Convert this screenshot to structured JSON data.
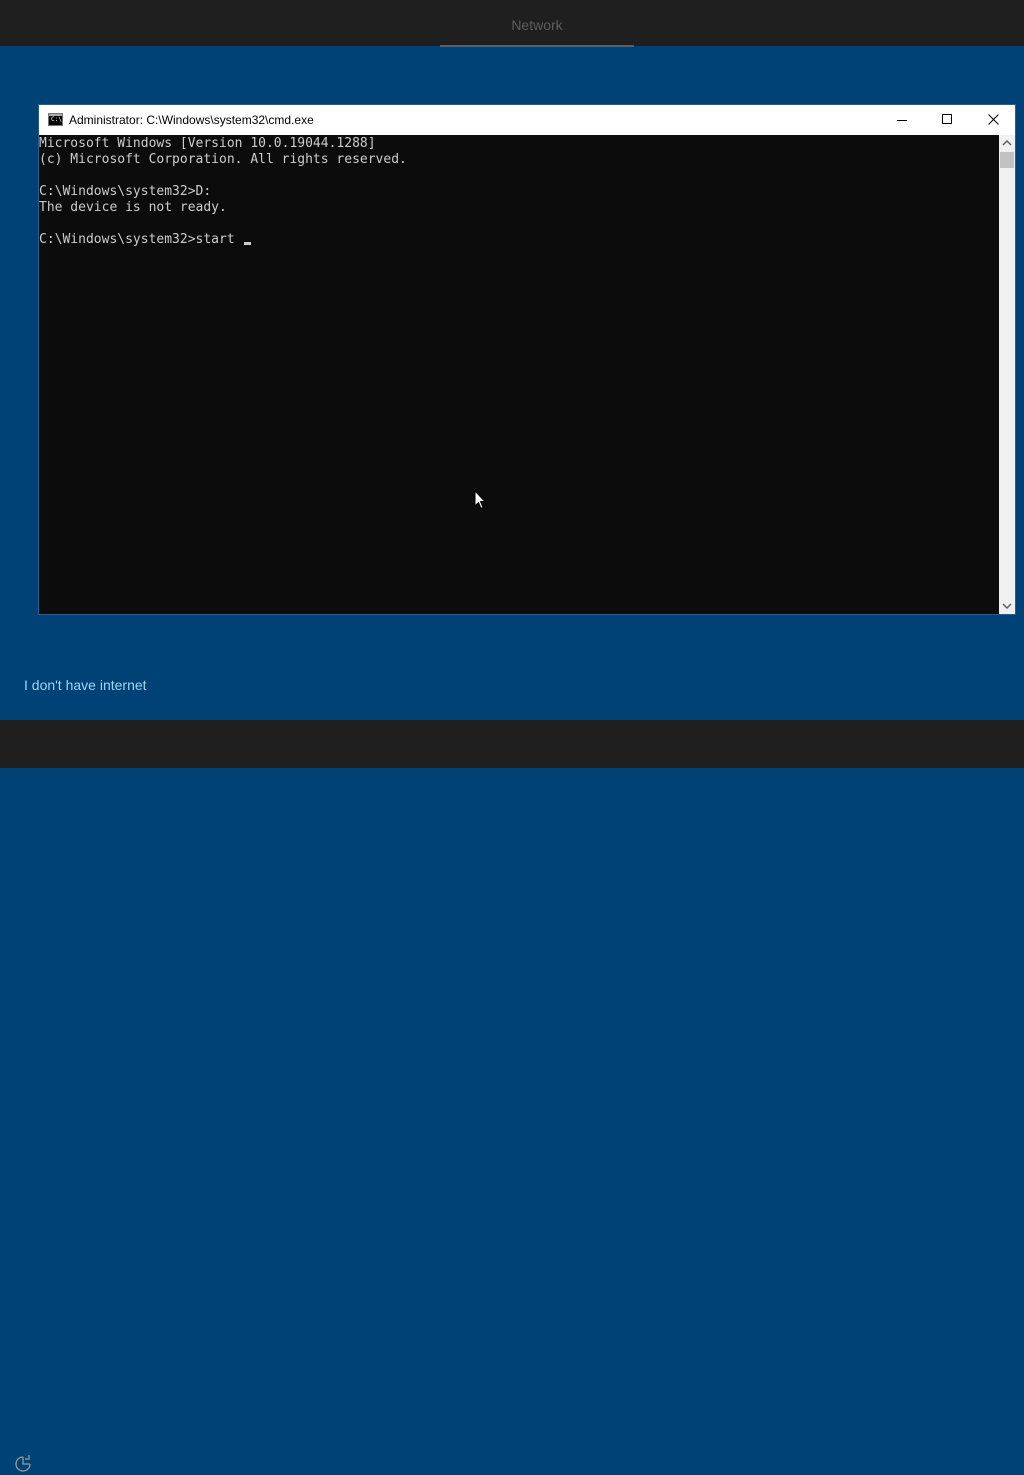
{
  "oobe": {
    "header_tab": "Network",
    "no_internet_link": "I don't have internet"
  },
  "window": {
    "title": "Administrator: C:\\Windows\\system32\\cmd.exe",
    "icon_text": "C:\\"
  },
  "console": {
    "lines": [
      "Microsoft Windows [Version 10.0.19044.1288]",
      "(c) Microsoft Corporation. All rights reserved.",
      "",
      "C:\\Windows\\system32>D:",
      "The device is not ready.",
      "",
      "C:\\Windows\\system32>start "
    ]
  },
  "icons": {
    "accessibility": "ease-of-access-icon",
    "cmd": "cmd-icon",
    "minimize": "minimize-icon",
    "maximize": "maximize-icon",
    "close": "close-icon",
    "pointer": "mouse-pointer-icon"
  },
  "colors": {
    "background": "#004275",
    "bars": "#1f1f1f",
    "console_bg": "#0c0c0c",
    "console_text": "#cccccc",
    "link": "#9fd3f6"
  }
}
